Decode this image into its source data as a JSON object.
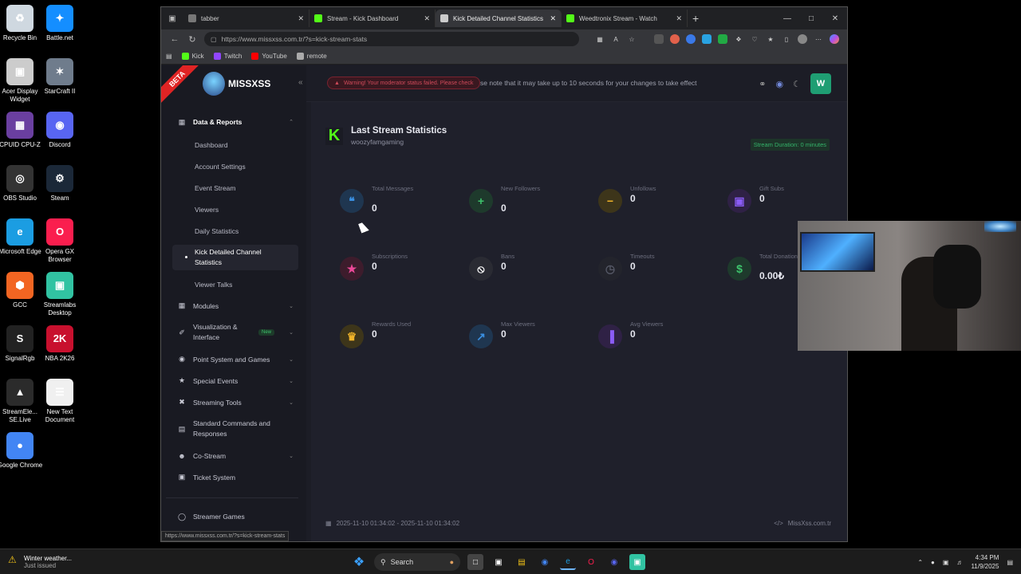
{
  "desktop": {
    "icons": [
      {
        "label": "Recycle Bin",
        "glyph": "♻",
        "color": "#cfd8e0"
      },
      {
        "label": "Battle.net",
        "glyph": "✦",
        "color": "#148eff"
      },
      {
        "label": "Acer Display Widget",
        "glyph": "▣",
        "color": "#cccccc"
      },
      {
        "label": "StarCraft II",
        "glyph": "✶",
        "color": "#6f7c8c"
      },
      {
        "label": "CPUID CPU-Z",
        "glyph": "▦",
        "color": "#6a3fa0"
      },
      {
        "label": "Discord",
        "glyph": "◉",
        "color": "#5865f2"
      },
      {
        "label": "OBS Studio",
        "glyph": "◎",
        "color": "#333333"
      },
      {
        "label": "Steam",
        "glyph": "⚙",
        "color": "#1b2838"
      },
      {
        "label": "Microsoft Edge",
        "glyph": "e",
        "color": "#1b9de2"
      },
      {
        "label": "Opera GX Browser",
        "glyph": "O",
        "color": "#fa1e4e"
      },
      {
        "label": "GCC",
        "glyph": "⬢",
        "color": "#f26522"
      },
      {
        "label": "Streamlabs Desktop",
        "glyph": "▣",
        "color": "#31c3a2"
      },
      {
        "label": "SignalRgb",
        "glyph": "S",
        "color": "#222222"
      },
      {
        "label": "NBA 2K26",
        "glyph": "2K",
        "color": "#c8102e"
      },
      {
        "label": "StreamEle... SE.Live",
        "glyph": "▲",
        "color": "#2b2b2b"
      },
      {
        "label": "New Text Document",
        "glyph": "☰",
        "color": "#f0f0f0"
      },
      {
        "label": "Google Chrome",
        "glyph": "●",
        "color": "#4285f4"
      }
    ]
  },
  "browser": {
    "tabs": [
      {
        "title": "tabber",
        "fav": "#777777",
        "active": false
      },
      {
        "title": "Stream - Kick Dashboard",
        "fav": "#53fc18",
        "active": false
      },
      {
        "title": "Kick Detailed Channel Statistics",
        "fav": "#cccccc",
        "active": true
      },
      {
        "title": "Weedtronix Stream - Watch",
        "fav": "#53fc18",
        "active": false
      }
    ],
    "url": "https://www.missxss.com.tr/?s=kick-stream-stats",
    "bookmarks": [
      {
        "label": "Kick",
        "fav": "#53fc18"
      },
      {
        "label": "Twitch",
        "fav": "#9146ff"
      },
      {
        "label": "YouTube",
        "fav": "#ff0000"
      },
      {
        "label": "remote",
        "fav": "#aaaaaa"
      }
    ],
    "status_url": "https://www.missxss.com.tr/?s=kick-stream-stats"
  },
  "app": {
    "beta": "BETA",
    "brand": "MISSXSS",
    "warning": "Warning! Your moderator status failed. Please check",
    "marquee": "se note that it may take up to 10 seconds for your changes to take effect",
    "avatar": "W",
    "menu": {
      "data_reports": "Data & Reports",
      "subs": [
        "Dashboard",
        "Account Settings",
        "Event Stream",
        "Viewers",
        "Daily Statistics",
        "Kick Detailed Channel Statistics",
        "Viewer Talks"
      ],
      "modules": "Modules",
      "visualization": "Visualization & Interface",
      "new_badge": "New",
      "point_system": "Point System and Games",
      "special_events": "Special Events",
      "streaming_tools": "Streaming Tools",
      "standard_commands": "Standard Commands and Responses",
      "co_stream": "Co-Stream",
      "ticket_system": "Ticket System",
      "streamer_games": "Streamer Games"
    },
    "card": {
      "title": "Last Stream Statistics",
      "channel": "woozyfamgaming",
      "duration": "Stream Duration: 0 minutes"
    },
    "stats": [
      {
        "label": "Total Messages",
        "value": "0",
        "icon": "❝",
        "bg": "#1f3650",
        "fg": "#3a8fe0"
      },
      {
        "label": "New Followers",
        "value": "0",
        "icon": "+",
        "bg": "#1e3a2c",
        "fg": "#3ec46d"
      },
      {
        "label": "Unfollows",
        "value": "0",
        "icon": "−",
        "bg": "#3d351a",
        "fg": "#f0b429"
      },
      {
        "label": "Gift Subs",
        "value": "0",
        "icon": "▣",
        "bg": "#2f2145",
        "fg": "#8b5cf6"
      },
      {
        "label": "Subscriptions",
        "value": "0",
        "icon": "★",
        "bg": "#3d1c2c",
        "fg": "#ec4899"
      },
      {
        "label": "Bans",
        "value": "0",
        "icon": "⦸",
        "bg": "#2a2b33",
        "fg": "#ffffff"
      },
      {
        "label": "Timeouts",
        "value": "0",
        "icon": "◷",
        "bg": "#23242c",
        "fg": "#555866"
      },
      {
        "label": "Total Donations",
        "value": "0.00₺",
        "icon": "$",
        "bg": "#1e3a2c",
        "fg": "#3ec46d"
      },
      {
        "label": "Rewards Used",
        "value": "0",
        "icon": "♛",
        "bg": "#3d351a",
        "fg": "#f0b429"
      },
      {
        "label": "Max Viewers",
        "value": "0",
        "icon": "↗",
        "bg": "#1f3650",
        "fg": "#3a8fe0"
      },
      {
        "label": "Avg Viewers",
        "value": "0",
        "icon": "▐",
        "bg": "#2f2145",
        "fg": "#8b5cf6"
      }
    ],
    "footer_date": "2025-11-10 01:34:02 - 2025-11-10 01:34:02",
    "footer_site": "MissXss.com.tr"
  },
  "taskbar": {
    "weather_title": "Winter weather...",
    "weather_sub": "Just issued",
    "search": "Search",
    "time": "4:34 PM",
    "date": "11/9/2025"
  }
}
